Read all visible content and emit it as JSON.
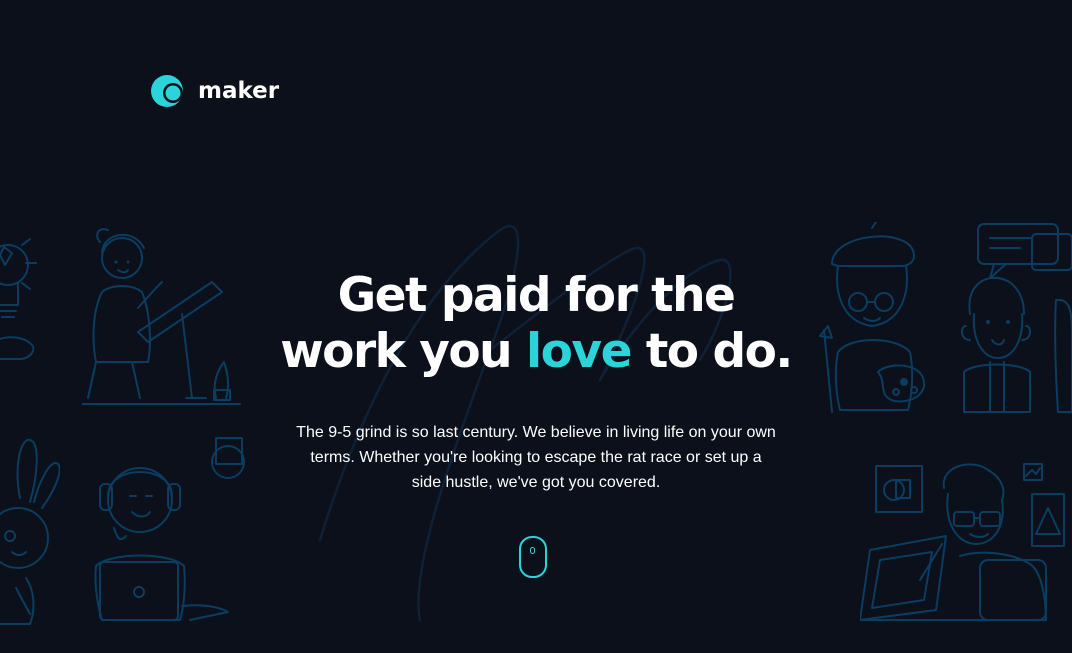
{
  "brand": {
    "name": "maker",
    "accent_color": "#2ad4d9",
    "background_color": "#0b101b",
    "logo_icon": "maker-logo-icon"
  },
  "hero": {
    "headline_line1": "Get paid for the",
    "headline_line2_before": "work you",
    "headline_line2_accent": "love",
    "headline_line2_after": "to do.",
    "description": "The 9-5 grind is so last century. We believe in living life on your own terms. Whether you're looking to escape the rat race or set up a side hustle, we've got you covered."
  },
  "scroll_indicator": {
    "icon": "mouse-scroll-icon"
  },
  "illustrations": [
    "lightbulb-hand-illustration",
    "artist-at-drafting-table-illustration",
    "bunny-ears-person-illustration",
    "person-with-headphones-laptop-illustration",
    "painter-with-beret-illustration",
    "person-with-speech-bubble-illustration",
    "designer-at-tablet-illustration"
  ]
}
